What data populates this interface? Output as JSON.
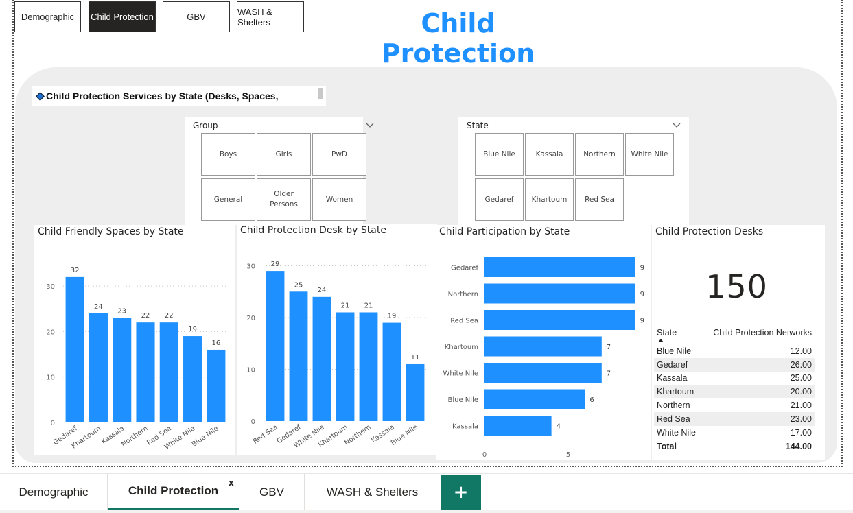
{
  "nav": {
    "buttons": [
      {
        "label": "Demographic",
        "active": false
      },
      {
        "label": "Child Protection",
        "active": true
      },
      {
        "label": "GBV",
        "active": false
      },
      {
        "label": "WASH & Shelters",
        "active": false
      }
    ]
  },
  "page_title": "Child Protection",
  "subtitle": "Child Protection Services by State (Desks, Spaces,",
  "group_slicer": {
    "header": "Group",
    "options": [
      "Boys",
      "Girls",
      "PwD",
      "General",
      "Older Persons",
      "Women"
    ]
  },
  "state_slicer": {
    "header": "State",
    "options": [
      "Blue Nile",
      "Kassala",
      "Northern",
      "White Nile",
      "Gedaref",
      "Khartoum",
      "Red Sea"
    ]
  },
  "chart_data": [
    {
      "type": "bar",
      "title": "Child Friendly Spaces by State",
      "categories": [
        "Gedaref",
        "Khartoum",
        "Kassala",
        "Northern",
        "Red Sea",
        "White Nile",
        "Blue Nile"
      ],
      "values": [
        32,
        24,
        23,
        22,
        22,
        19,
        16
      ],
      "yticks": [
        0,
        10,
        20,
        30
      ],
      "ylim": [
        0,
        35
      ],
      "color": "#1E90FF"
    },
    {
      "type": "bar",
      "title": "Child Protection Desk by State",
      "categories": [
        "Red Sea",
        "Gedaref",
        "White Nile",
        "Khartoum",
        "Northern",
        "Kassala",
        "Blue Nile"
      ],
      "values": [
        29,
        25,
        24,
        21,
        21,
        19,
        11
      ],
      "yticks": [
        0,
        10,
        20,
        30
      ],
      "ylim": [
        0,
        31
      ],
      "color": "#1E90FF"
    },
    {
      "type": "bar",
      "orientation": "horizontal",
      "title": "Child Participation by State",
      "categories": [
        "Gedaref",
        "Northern",
        "Red Sea",
        "Khartoum",
        "White Nile",
        "Blue Nile",
        "Kassala"
      ],
      "values": [
        9,
        9,
        9,
        7,
        7,
        6,
        4
      ],
      "xticks": [
        0,
        5
      ],
      "xlim": [
        0,
        10
      ],
      "color": "#1E90FF"
    }
  ],
  "kpi": {
    "title": "Child Protection Desks",
    "value": "150"
  },
  "table": {
    "headers": [
      "State",
      "Child Protection Networks"
    ],
    "rows": [
      [
        "Blue Nile",
        "12.00"
      ],
      [
        "Gedaref",
        "26.00"
      ],
      [
        "Kassala",
        "25.00"
      ],
      [
        "Khartoum",
        "20.00"
      ],
      [
        "Northern",
        "21.00"
      ],
      [
        "Red Sea",
        "23.00"
      ],
      [
        "White Nile",
        "17.00"
      ]
    ],
    "total_label": "Total",
    "total_value": "144.00"
  },
  "tabs": {
    "items": [
      {
        "label": "Demographic",
        "active": false
      },
      {
        "label": "Child Protection",
        "active": true
      },
      {
        "label": "GBV",
        "active": false
      },
      {
        "label": "WASH & Shelters",
        "active": false
      }
    ],
    "close_label": "x",
    "add_label": "+"
  }
}
